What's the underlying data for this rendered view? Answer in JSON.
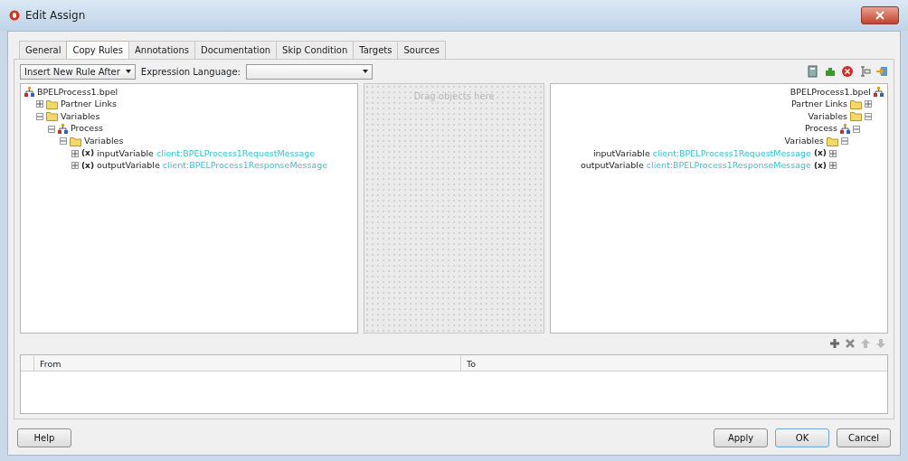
{
  "window": {
    "title": "Edit Assign"
  },
  "tabs": [
    {
      "label": "General",
      "selected": false
    },
    {
      "label": "Copy Rules",
      "selected": true
    },
    {
      "label": "Annotations",
      "selected": false
    },
    {
      "label": "Documentation",
      "selected": false
    },
    {
      "label": "Skip Condition",
      "selected": false
    },
    {
      "label": "Targets",
      "selected": false
    },
    {
      "label": "Sources",
      "selected": false
    }
  ],
  "toolbar": {
    "rule_dropdown": "Insert New Rule After",
    "expression_label": "Expression Language:"
  },
  "source_tree": [
    {
      "kind": "file",
      "label": "BPELProcess1.bpel",
      "children": [
        {
          "kind": "folder",
          "label": "Partner Links",
          "expanded": false
        },
        {
          "kind": "folder",
          "label": "Variables",
          "expanded": true,
          "children": [
            {
              "kind": "process",
              "label": "Process",
              "expanded": true,
              "children": [
                {
                  "kind": "folder",
                  "label": "Variables",
                  "expanded": true,
                  "children": [
                    {
                      "kind": "variable",
                      "icon_text": "(x)",
                      "label": "inputVariable",
                      "type": "client:BPELProcess1RequestMessage",
                      "expanded": false
                    },
                    {
                      "kind": "variable",
                      "icon_text": "(x)",
                      "label": "outputVariable",
                      "type": "client:BPELProcess1ResponseMessage",
                      "expanded": false
                    }
                  ]
                }
              ]
            }
          ]
        }
      ]
    }
  ],
  "drop_area": {
    "hint": "Drag objects here"
  },
  "target_tree": [
    {
      "kind": "file",
      "label": "BPELProcess1.bpel",
      "children": [
        {
          "kind": "folder",
          "label": "Partner Links",
          "expanded": false
        },
        {
          "kind": "folder",
          "label": "Variables",
          "expanded": true,
          "children": [
            {
              "kind": "process",
              "label": "Process",
              "expanded": true,
              "children": [
                {
                  "kind": "folder",
                  "label": "Variables",
                  "expanded": true,
                  "children": [
                    {
                      "kind": "variable",
                      "icon_text": "(x)",
                      "label": "inputVariable",
                      "type": "client:BPELProcess1RequestMessage",
                      "expanded": false
                    },
                    {
                      "kind": "variable",
                      "icon_text": "(x)",
                      "label": "outputVariable",
                      "type": "client:BPELProcess1ResponseMessage",
                      "expanded": false
                    }
                  ]
                }
              ]
            }
          ]
        }
      ]
    }
  ],
  "rules_table": {
    "columns": [
      "From",
      "To"
    ]
  },
  "buttons": {
    "help": "Help",
    "apply": "Apply",
    "ok": "OK",
    "cancel": "Cancel"
  }
}
